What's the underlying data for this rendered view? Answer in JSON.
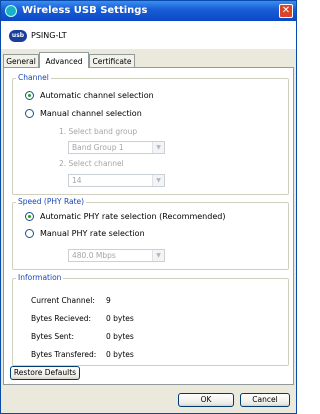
{
  "window": {
    "title": "Wireless USB Settings",
    "device_badge": "usb",
    "device_name": "PSING-LT"
  },
  "tabs": [
    "General",
    "Advanced",
    "Certificate"
  ],
  "active_tab": "Advanced",
  "channel": {
    "group_label": "Channel",
    "auto_label": "Automatic channel selection",
    "manual_label": "Manual channel selection",
    "selected": "auto",
    "band_group_label": "1. Select band group",
    "band_group_value": "Band Group 1",
    "channel_label": "2. Select channel",
    "channel_value": "14"
  },
  "speed": {
    "group_label": "Speed (PHY Rate)",
    "auto_label": "Automatic PHY rate selection (Recommended)",
    "manual_label": "Manual PHY rate selection",
    "selected": "auto",
    "rate_value": "480.0 Mbps"
  },
  "information": {
    "group_label": "Information",
    "rows": [
      {
        "key": "Current Channel:",
        "value": "9"
      },
      {
        "key": "Bytes Recieved:",
        "value": "0 bytes"
      },
      {
        "key": "Bytes Sent:",
        "value": "0 bytes"
      },
      {
        "key": "Bytes Transfered:",
        "value": "0 bytes"
      }
    ]
  },
  "buttons": {
    "restore_defaults": "Restore Defaults",
    "ok": "OK",
    "cancel": "Cancel"
  },
  "icons": {
    "title_icon": "wireless-usb-icon",
    "close_icon": "close-icon",
    "dropdown_icon": "chevron-down-icon"
  },
  "colors": {
    "titlebar": "#0a48c6",
    "group_label": "#1a47b8",
    "radio_selected": "#21a121",
    "window_bg": "#ebe9dc"
  }
}
